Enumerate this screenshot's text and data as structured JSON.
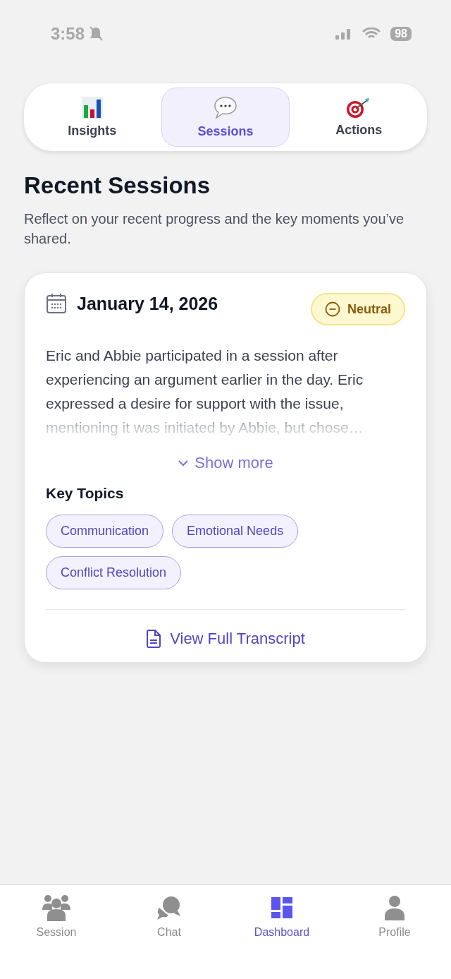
{
  "status_bar": {
    "time": "3:58",
    "battery": "98"
  },
  "tabs": [
    {
      "label": "Insights",
      "kind": "chart",
      "selected": false
    },
    {
      "label": "Sessions",
      "kind": "bubble",
      "selected": true
    },
    {
      "label": "Actions",
      "kind": "target",
      "selected": false
    }
  ],
  "header": {
    "title": "Recent Sessions",
    "subtitle": "Reflect on your recent progress and the key moments you’ve shared."
  },
  "sessions": [
    {
      "date": "January 14, 2026",
      "mood": "Neutral",
      "summary": "Eric and Abbie participated in a session after experiencing an argument earlier in the day. Eric expressed a desire for support with the issue, mentioning it was initiated by Abbie, but chose…",
      "expanded": false,
      "show_more": "Show more",
      "topics_title": "Key Topics",
      "topics": [
        "Communication",
        "Emotional Needs",
        "Conflict Resolution"
      ],
      "transcript_link": "View Full Transcript"
    }
  ],
  "bottom_nav": [
    {
      "label": "Session",
      "kind": "group",
      "selected": false
    },
    {
      "label": "Chat",
      "kind": "chat",
      "selected": false
    },
    {
      "label": "Dashboard",
      "kind": "dashboard",
      "selected": true
    },
    {
      "label": "Profile",
      "kind": "person",
      "selected": false
    }
  ]
}
